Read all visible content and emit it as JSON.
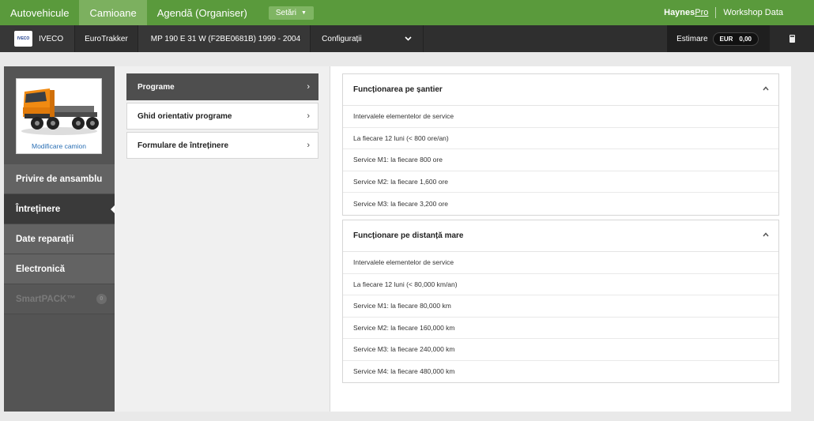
{
  "topnav": {
    "tabs": [
      {
        "label": "Autovehicule",
        "active": false
      },
      {
        "label": "Camioane",
        "active": true
      },
      {
        "label": "Agendă (Organiser)",
        "active": false
      }
    ],
    "settings_label": "Setări",
    "settings_caret": "▼",
    "brand_main": "Haynes",
    "brand_pro": "Pro",
    "brand_product": "Workshop Data"
  },
  "vehicle": {
    "logo_text": "IVECO",
    "make": "IVECO",
    "model": "EuroTrakker",
    "type": "MP 190 E 31 W (F2BE0681B) 1999 - 2004",
    "config_label": "Configurații",
    "config_chevron": "⌄",
    "estimate_label": "Estimare",
    "currency": "EUR",
    "amount": "0,00"
  },
  "sidebar": {
    "truck_link": "Modificare camion",
    "items": [
      {
        "label": "Privire de ansamblu"
      },
      {
        "label": "Întreținere"
      },
      {
        "label": "Date reparații"
      },
      {
        "label": "Electronică"
      },
      {
        "label": "SmartPACK™",
        "badge": "0"
      }
    ]
  },
  "submenu": {
    "items": [
      {
        "label": "Programe",
        "arrow": "›"
      },
      {
        "label": "Ghid orientativ programe",
        "arrow": "›"
      },
      {
        "label": "Formulare de întreținere",
        "arrow": "›"
      }
    ]
  },
  "panels": [
    {
      "title": "Funcționarea pe șantier",
      "rows": [
        "Intervalele elementelor de service",
        "La fiecare 12 luni (< 800 ore/an)",
        "Service M1: la fiecare 800 ore",
        "Service M2: la fiecare 1,600 ore",
        "Service M3: la fiecare 3,200 ore"
      ]
    },
    {
      "title": "Funcționare pe distanță mare",
      "rows": [
        "Intervalele elementelor de service",
        "La fiecare 12 luni (< 80,000 km/an)",
        "Service M1: la fiecare 80,000 km",
        "Service M2: la fiecare 160,000 km",
        "Service M3: la fiecare 240,000 km",
        "Service M4: la fiecare 480,000 km"
      ]
    }
  ],
  "colors": {
    "topbar": "#5a9a3c",
    "active_tab": "#7cb05f",
    "vehicle_bar": "#2f2f2f",
    "sidebar": "#545454",
    "link": "#2a6fb4"
  }
}
